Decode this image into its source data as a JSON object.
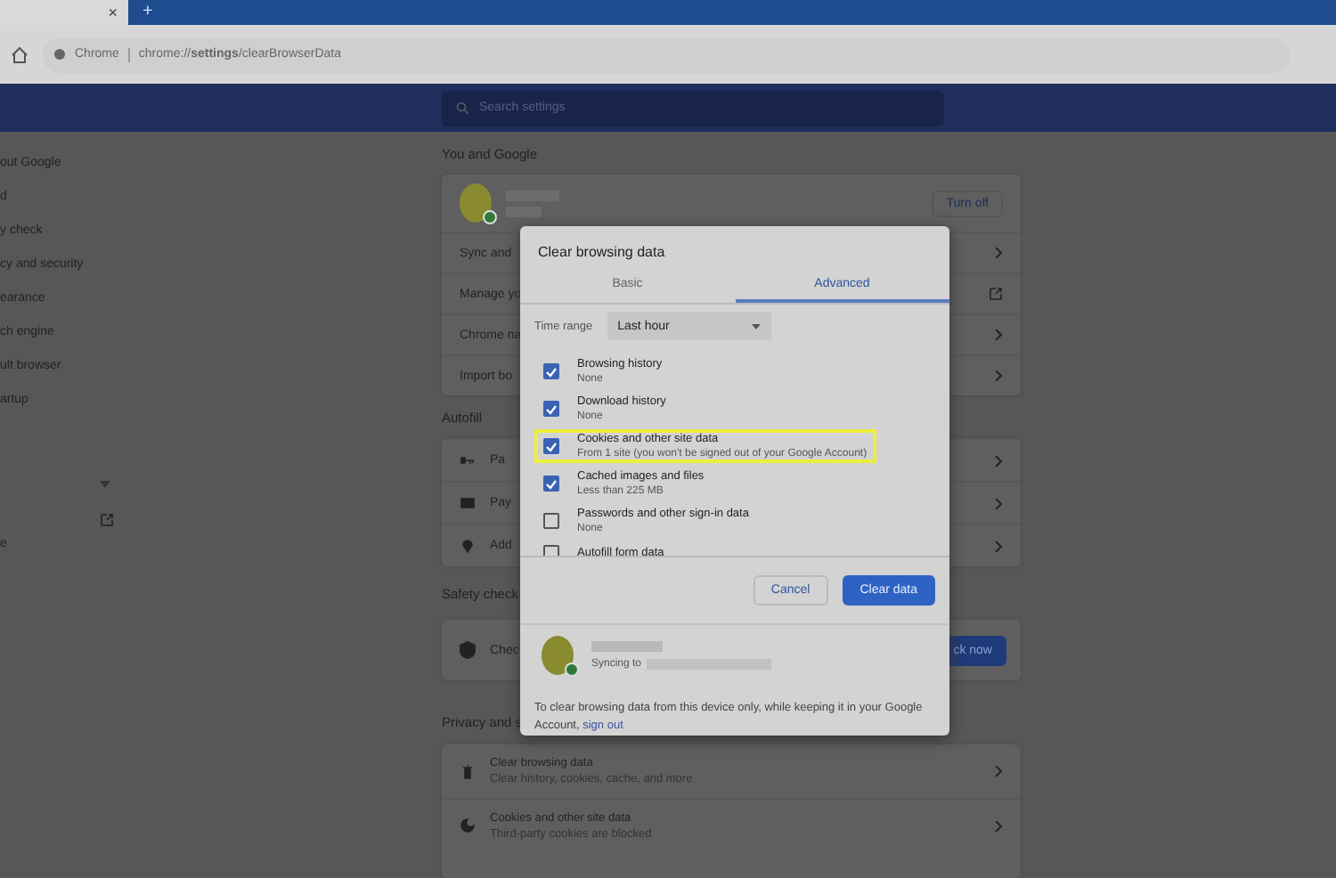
{
  "browser": {
    "tab_close": "×",
    "new_tab": "+",
    "site_label": "Chrome",
    "url": "chrome://**settings**/clearBrowserData"
  },
  "header": {
    "search": {
      "placeholder": "Search settings"
    }
  },
  "sidebar": {
    "items": [
      {
        "label": "out Google"
      },
      {
        "label": "d"
      },
      {
        "label": "y check"
      },
      {
        "label": "cy and security"
      },
      {
        "label": "earance"
      },
      {
        "label": "ch engine"
      },
      {
        "label": "ult browser"
      },
      {
        "label": "artup"
      }
    ],
    "footer_item": "e"
  },
  "you_and_google": {
    "title": "You and Google",
    "turn_off": "Turn off",
    "rows": [
      {
        "label": "Sync and",
        "kind": "chevron"
      },
      {
        "label": "Manage yo",
        "kind": "external"
      },
      {
        "label": "Chrome na",
        "kind": "chevron"
      },
      {
        "label": "Import bo",
        "kind": "chevron"
      }
    ]
  },
  "autofill": {
    "title": "Autofill",
    "rows": [
      {
        "label": "Pa",
        "kind": "key"
      },
      {
        "label": "Pay",
        "kind": "card"
      },
      {
        "label": "Add",
        "kind": "pin"
      }
    ]
  },
  "safety_check": {
    "title": "Safety check",
    "row_label": "Chec",
    "button": "ck now"
  },
  "privacy": {
    "title": "Privacy and s",
    "rows": [
      {
        "title": "Clear browsing data",
        "subtitle": "Clear history, cookies, cache, and more",
        "kind": "trash"
      },
      {
        "title": "Cookies and other site data",
        "subtitle": "Third-party cookies are blocked",
        "kind": "cookie"
      }
    ]
  },
  "dialog": {
    "title": "Clear browsing data",
    "tabs": [
      {
        "label": "Basic",
        "selected": false
      },
      {
        "label": "Advanced",
        "selected": true
      }
    ],
    "time_range": {
      "label": "Time range",
      "value": "Last hour"
    },
    "items": [
      {
        "label": "Browsing history",
        "detail": "None",
        "checked": true,
        "highlighted": false
      },
      {
        "label": "Download history",
        "detail": "None",
        "checked": true,
        "highlighted": false
      },
      {
        "label": "Cookies and other site data",
        "detail": "From 1 site (you won't be signed out of your Google Account)",
        "checked": true,
        "highlighted": true
      },
      {
        "label": "Cached images and files",
        "detail": "Less than 225 MB",
        "checked": true,
        "highlighted": false
      },
      {
        "label": "Passwords and other sign-in data",
        "detail": "None",
        "checked": false,
        "highlighted": false
      },
      {
        "label": "Autofill form data",
        "checked": false,
        "highlighted": false
      }
    ],
    "buttons": [
      {
        "label": "Cancel",
        "kind": "secondary"
      },
      {
        "label": "Clear data",
        "kind": "primary"
      }
    ],
    "account": {
      "syncing": "Syncing to"
    },
    "footer": {
      "text": "To clear browsing data from this device only, while keeping it in your Google Account,",
      "link": "sign out"
    }
  }
}
